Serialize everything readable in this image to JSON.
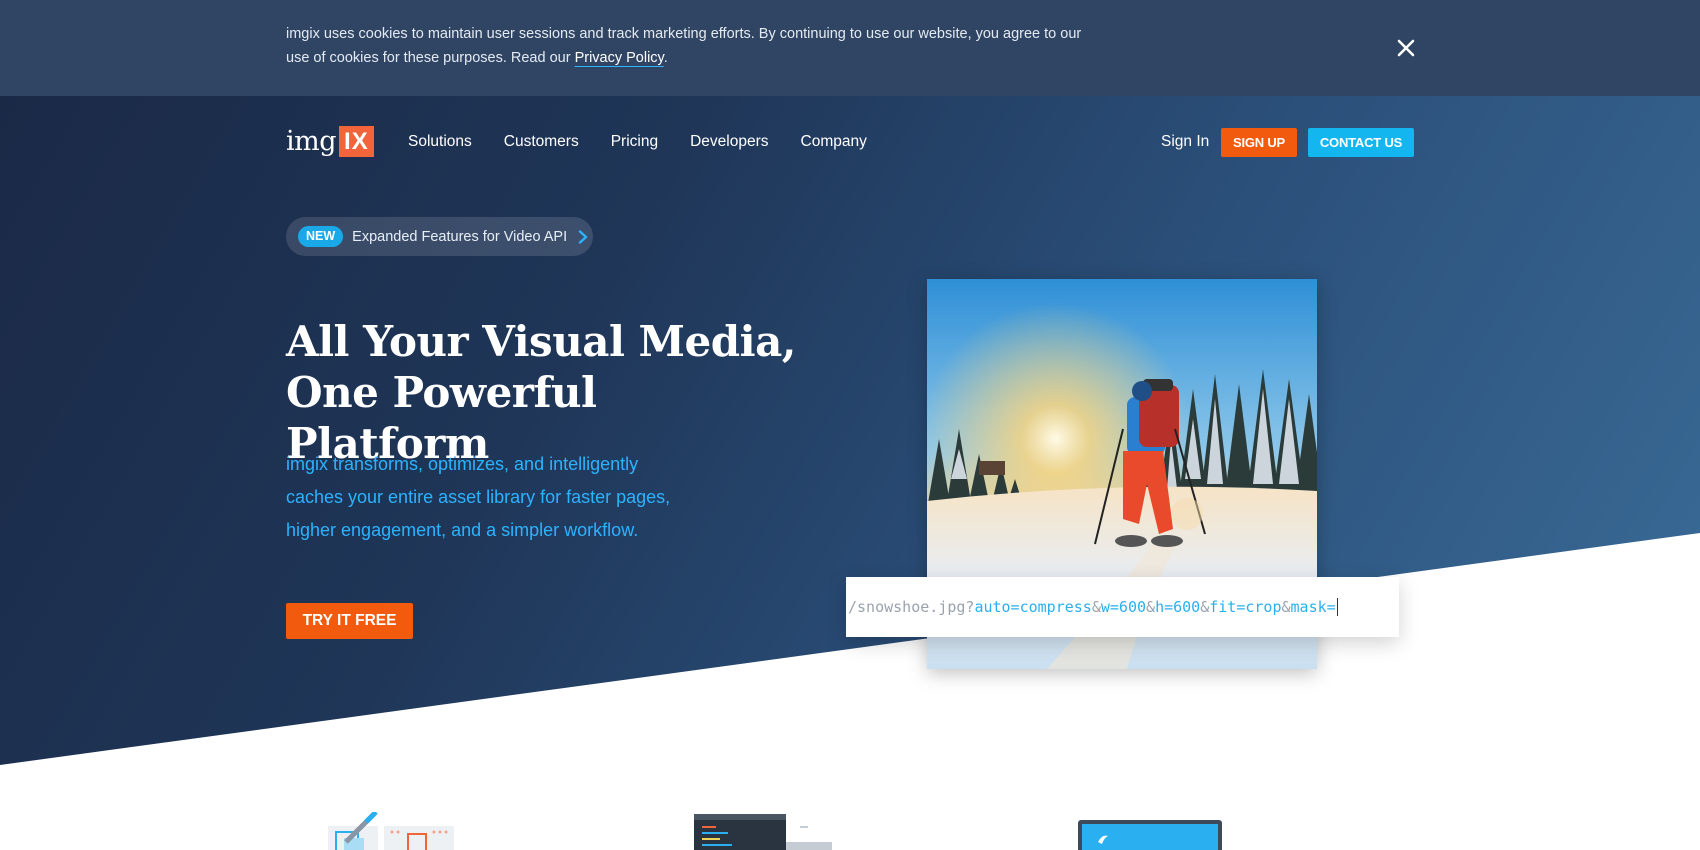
{
  "cookie_banner": {
    "text_before_link": "imgix uses cookies to maintain user sessions and track marketing efforts. By continuing to use our website, you agree to our use of cookies for these purposes. Read our ",
    "link_text": "Privacy Policy",
    "text_after_link": ".",
    "close_icon": "close-icon"
  },
  "header": {
    "logo_word": "img",
    "logo_mark": "IX",
    "nav": [
      "Solutions",
      "Customers",
      "Pricing",
      "Developers",
      "Company"
    ],
    "sign_in": "Sign In",
    "sign_up": "SIGN UP",
    "contact": "CONTACT US"
  },
  "announcement": {
    "badge": "NEW",
    "text": "Expanded Features for Video API",
    "icon": "chevron-right-icon"
  },
  "hero": {
    "headline_line1": "All Your Visual Media,",
    "headline_line2": "One Powerful Platform",
    "subcopy": "imgix transforms, optimizes, and intelligently caches your entire asset library for faster pages, higher engagement, and a simpler workflow.",
    "cta": "TRY IT FREE"
  },
  "url_demo": {
    "path": "/snowshoe.jpg?",
    "params": [
      "auto=compress",
      "w=600",
      "h=600",
      "fit=crop",
      "mask="
    ],
    "separator": "&"
  },
  "colors": {
    "accent_orange": "#f25a0e",
    "accent_blue": "#14b6f0",
    "link_blue": "#2cb3ff",
    "banner_bg": "#2f4563"
  }
}
